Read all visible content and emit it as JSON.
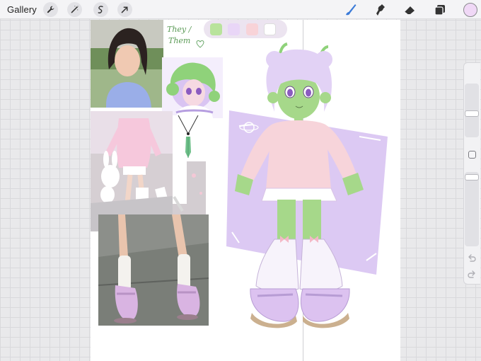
{
  "toolbar": {
    "gallery_label": "Gallery",
    "left_tools": [
      "wrench-icon",
      "magic-wand-icon",
      "selection-icon",
      "transform-arrow-icon"
    ],
    "right_tools": [
      "brush-icon",
      "smudge-icon",
      "eraser-icon",
      "layers-icon"
    ],
    "current_color": "#f0d8f6"
  },
  "canvas": {
    "note_line1": "They /",
    "note_line2": "Them",
    "palette": [
      "#b9e39c",
      "#e9d6f7",
      "#f8d3d8",
      "#ffffff"
    ],
    "accent_colors": {
      "skin": "#a6d88a",
      "lavender": "#e2d2f5",
      "pink": "#f7d4da",
      "purple_bg": "#dcc9f3"
    }
  },
  "sidebar": {
    "controls": [
      "brush-size-slider",
      "modify-button",
      "opacity-slider",
      "undo-icon",
      "redo-icon"
    ]
  }
}
